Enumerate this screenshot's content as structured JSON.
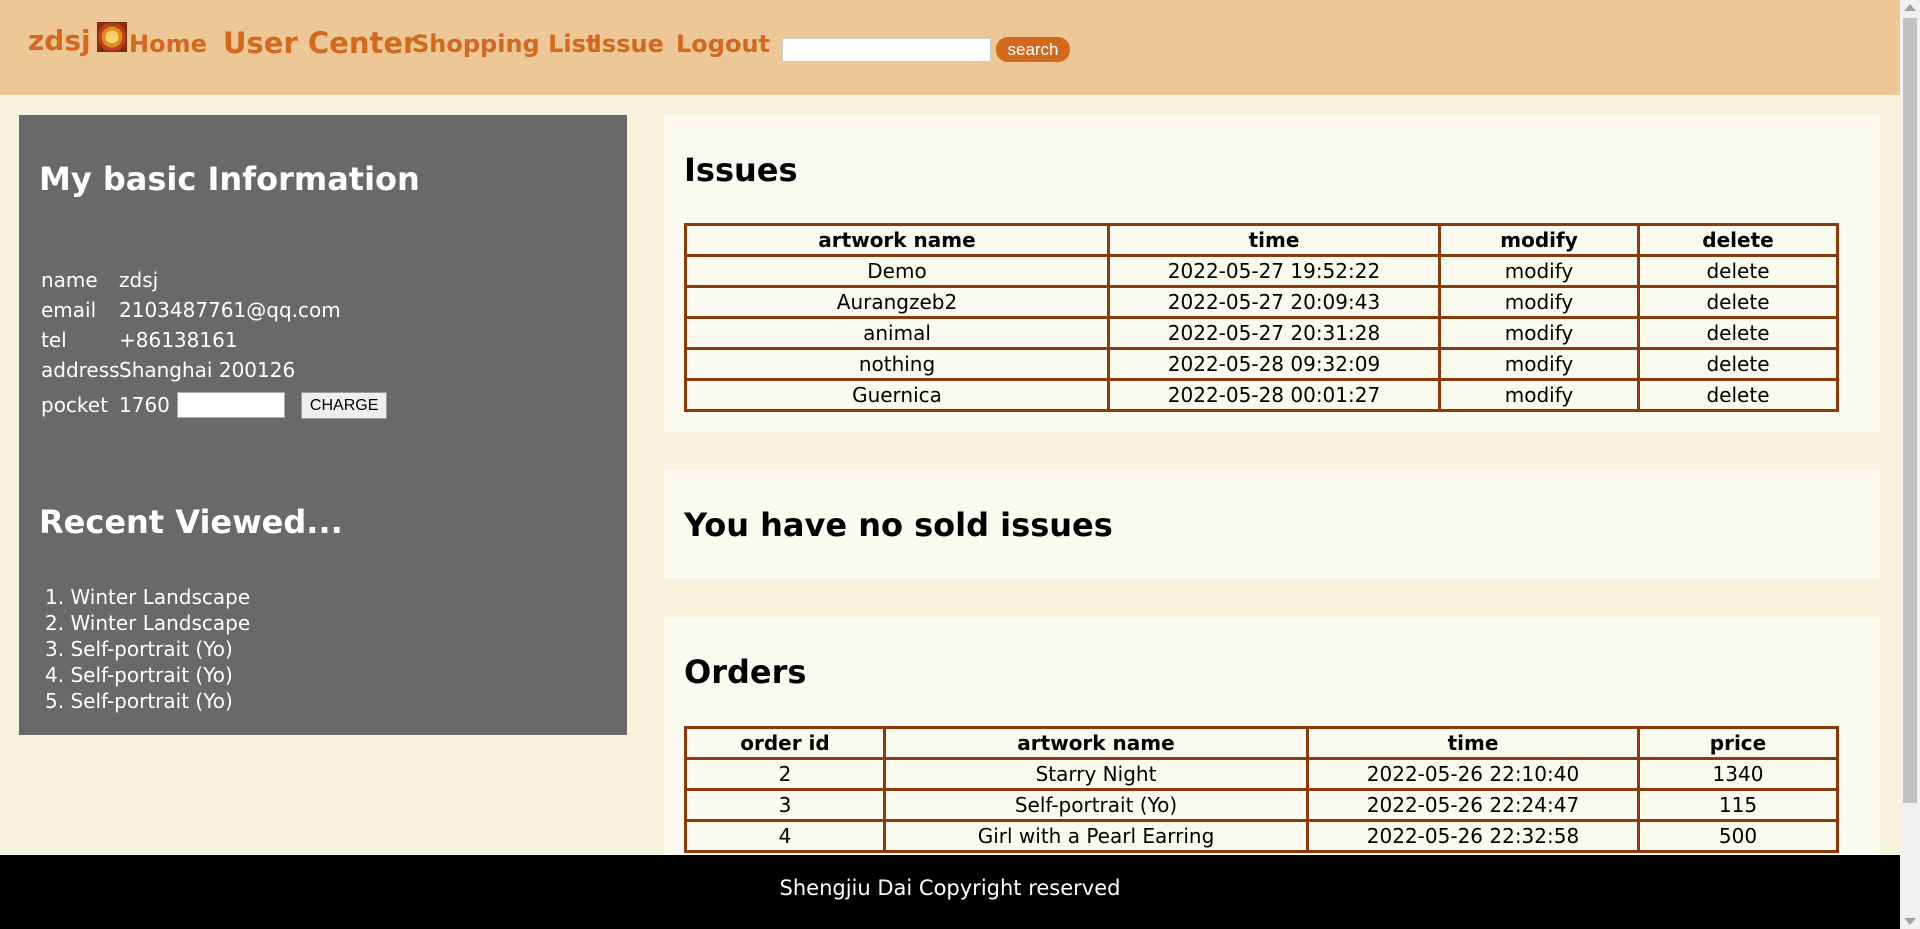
{
  "nav": {
    "brand": "zdsj",
    "links": [
      "Home",
      "User Center",
      "Shopping List",
      "Issue",
      "Logout"
    ],
    "search_value": "",
    "search_button": "search"
  },
  "sidebar": {
    "title": "My basic Information",
    "info": [
      {
        "key": "name",
        "value": "zdsj"
      },
      {
        "key": "email",
        "value": "2103487761@qq.com"
      },
      {
        "key": "tel",
        "value": "+86138161"
      },
      {
        "key": "address",
        "value": "Shanghai 200126"
      }
    ],
    "pocket_label": "pocket",
    "pocket_value": "1760",
    "charge_input_value": "",
    "charge_button": "CHARGE",
    "recent_title": "Recent Viewed...",
    "recent": [
      "1. Winter Landscape",
      "2. Winter Landscape",
      "3. Self-portrait (Yo)",
      "4. Self-portrait (Yo)",
      "5. Self-portrait (Yo)"
    ]
  },
  "issues": {
    "title": "Issues",
    "headers": [
      "artwork name",
      "time",
      "modify",
      "delete"
    ],
    "rows": [
      [
        "Demo",
        "2022-05-27 19:52:22",
        "modify",
        "delete"
      ],
      [
        "Aurangzeb2",
        "2022-05-27 20:09:43",
        "modify",
        "delete"
      ],
      [
        "animal",
        "2022-05-27 20:31:28",
        "modify",
        "delete"
      ],
      [
        "nothing",
        "2022-05-28 09:32:09",
        "modify",
        "delete"
      ],
      [
        "Guernica",
        "2022-05-28 00:01:27",
        "modify",
        "delete"
      ]
    ]
  },
  "sold": {
    "title": "You have no sold issues"
  },
  "orders": {
    "title": "Orders",
    "headers": [
      "order id",
      "artwork name",
      "time",
      "price"
    ],
    "rows": [
      [
        "2",
        "Starry Night",
        "2022-05-26 22:10:40",
        "1340"
      ],
      [
        "3",
        "Self-portrait (Yo)",
        "2022-05-26 22:24:47",
        "115"
      ],
      [
        "4",
        "Girl with a Pearl Earring",
        "2022-05-26 22:32:58",
        "500"
      ]
    ]
  },
  "footer": "Shengjiu Dai Copyright reserved"
}
